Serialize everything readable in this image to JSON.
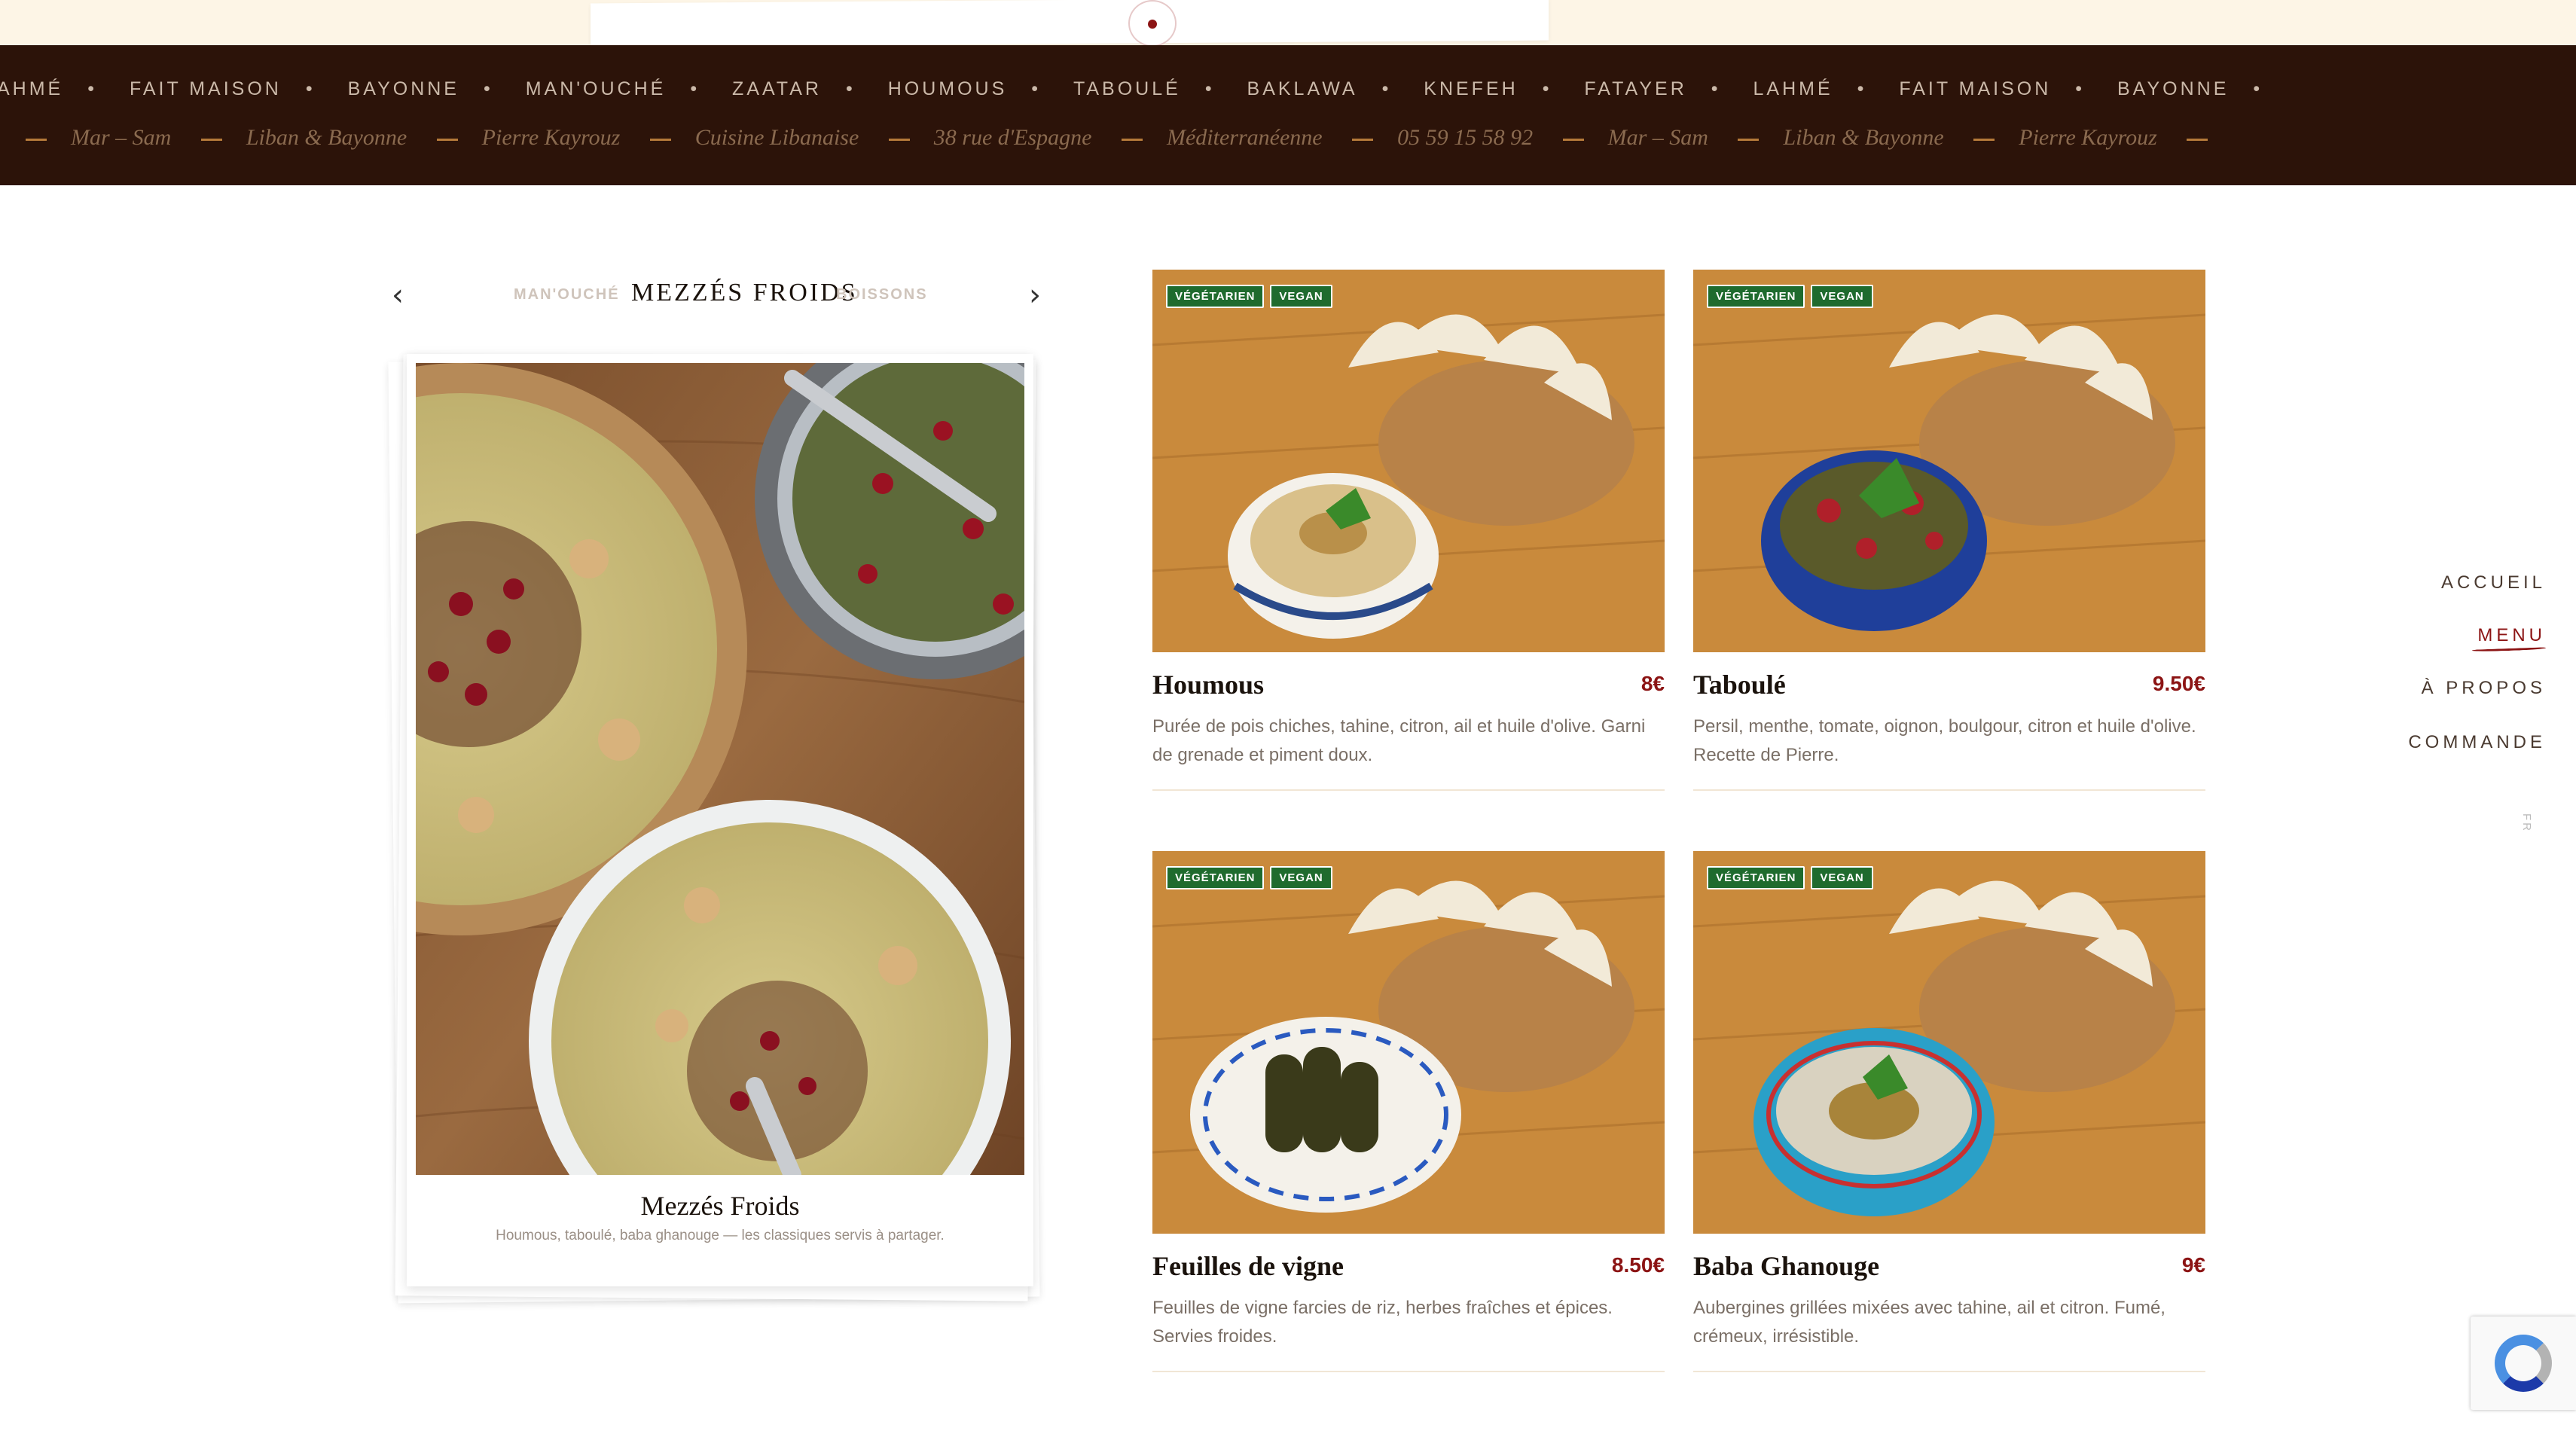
{
  "marquee": {
    "row1": [
      "AHMÉ",
      "FAIT MAISON",
      "BAYONNE",
      "MAN'OUCHÉ",
      "ZAATAR",
      "HOUMOUS",
      "TABOULÉ",
      "BAKLAWA",
      "KNEFEH",
      "FATAYER",
      "LAHMÉ",
      "FAIT MAISON",
      "BAYONNE"
    ],
    "row1_separator": "•",
    "row2": [
      "Mar – Sam",
      "Liban & Bayonne",
      "Pierre Kayrouz",
      "Cuisine Libanaise",
      "38 rue d'Espagne",
      "Méditerranéenne",
      "05 59 15 58 92",
      "Mar – Sam",
      "Liban & Bayonne",
      "Pierre Kayrouz"
    ]
  },
  "category_nav": {
    "prev": "MAN'OUCHÉ",
    "current": "MEZZÉS FROIDS",
    "next": "BOISSONS",
    "prev_arrow": "‹",
    "next_arrow": "›"
  },
  "feature": {
    "title": "Mezzés Froids",
    "description": "Houmous, taboulé, baba ghanouge — les classiques servis à partager."
  },
  "menu_items": [
    {
      "name": "Houmous",
      "price": "8€",
      "badges": [
        "VÉGÉTARIEN",
        "VEGAN"
      ],
      "description": "Purée de pois chiches, tahine, citron, ail et huile d'olive. Garni de grenade et piment doux."
    },
    {
      "name": "Taboulé",
      "price": "9.50€",
      "badges": [
        "VÉGÉTARIEN",
        "VEGAN"
      ],
      "description": "Persil, menthe, tomate, oignon, boulgour, citron et huile d'olive. Recette de Pierre."
    },
    {
      "name": "Feuilles de vigne",
      "price": "8.50€",
      "badges": [
        "VÉGÉTARIEN",
        "VEGAN"
      ],
      "description": "Feuilles de vigne farcies de riz, herbes fraîches et épices. Servies froides."
    },
    {
      "name": "Baba Ghanouge",
      "price": "9€",
      "badges": [
        "VÉGÉTARIEN",
        "VEGAN"
      ],
      "description": "Aubergines grillées mixées avec tahine, ail et citron. Fumé, crémeux, irrésistible."
    }
  ],
  "side_nav": {
    "items": [
      "ACCUEIL",
      "MENU",
      "À PROPOS",
      "COMMANDE"
    ],
    "active": "MENU",
    "lang": "FR"
  },
  "colors": {
    "band_bg": "#2c1309",
    "accent_red": "#8c1414",
    "badge_green": "#1f6b2e",
    "cream": "#fdf5e6"
  }
}
